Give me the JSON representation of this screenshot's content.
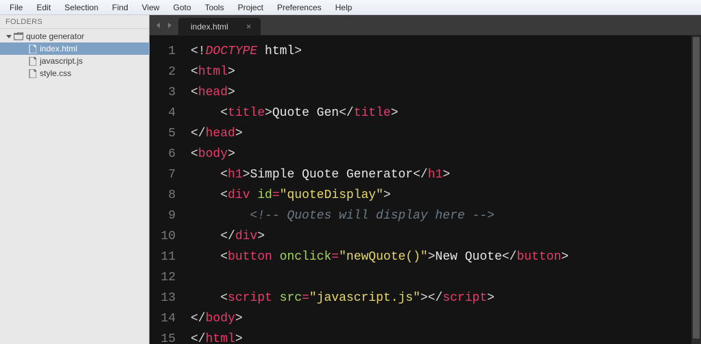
{
  "menu": [
    "File",
    "Edit",
    "Selection",
    "Find",
    "View",
    "Goto",
    "Tools",
    "Project",
    "Preferences",
    "Help"
  ],
  "sidebar": {
    "header": "FOLDERS",
    "folder": "quote generator",
    "files": [
      "index.html",
      "javascript.js",
      "style.css"
    ],
    "selected": "index.html"
  },
  "tab": {
    "title": "index.html",
    "close": "×"
  },
  "lines": [
    "1",
    "2",
    "3",
    "4",
    "5",
    "6",
    "7",
    "8",
    "9",
    "10",
    "11",
    "12",
    "13",
    "14",
    "15"
  ],
  "code": {
    "l1_doctype": "DOCTYPE",
    "l1_html": "html",
    "tag_html": "html",
    "tag_head": "head",
    "tag_title": "title",
    "title_text": "Quote Gen",
    "tag_body": "body",
    "tag_h1": "h1",
    "h1_text": "Simple Quote Generator",
    "tag_div": "div",
    "attr_id": "id",
    "id_val": "\"quoteDisplay\"",
    "comment": "<!-- Quotes will display here -->",
    "tag_button": "button",
    "attr_onclick": "onclick",
    "onclick_val": "\"newQuote()\"",
    "button_text": "New Quote",
    "tag_script": "script",
    "attr_src": "src",
    "src_val": "\"javascript.js\""
  }
}
